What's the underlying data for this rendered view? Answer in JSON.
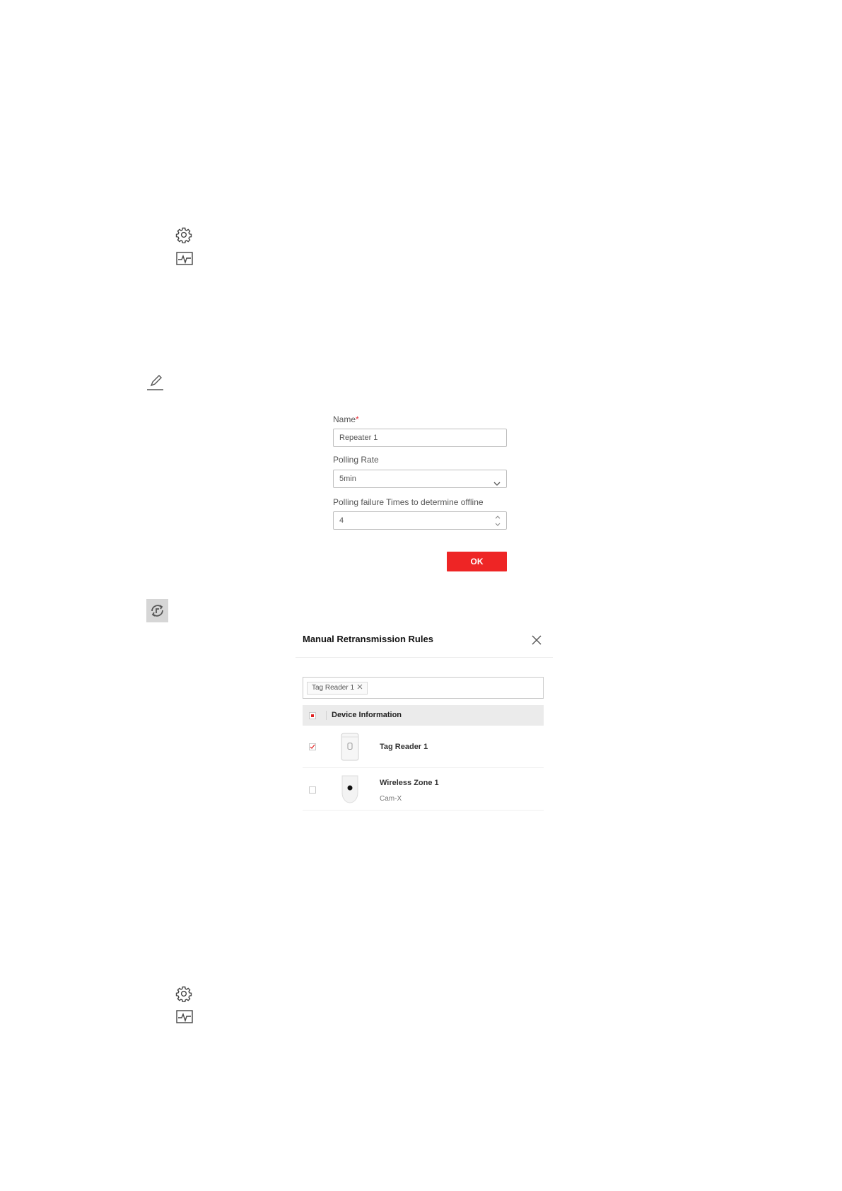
{
  "icons": {
    "gear": "gear-icon",
    "monitor": "status-monitor-icon",
    "edit": "edit-pencil-icon",
    "retransmission": "retransmission-icon"
  },
  "settings_form": {
    "name_label": "Name",
    "required_mark": "*",
    "name_value": "Repeater 1",
    "polling_rate_label": "Polling Rate",
    "polling_rate_value": "5min",
    "polling_failure_label": "Polling failure Times to determine offline",
    "polling_failure_value": "4",
    "ok_label": "OK"
  },
  "retransmission_panel": {
    "title": "Manual Retransmission Rules",
    "selected_tag": "Tag Reader 1",
    "header_label": "Device Information",
    "devices": [
      {
        "name": "Tag Reader 1",
        "subtitle": "",
        "checked": true
      },
      {
        "name": "Wireless Zone 1",
        "subtitle": "Cam-X",
        "checked": false
      }
    ]
  },
  "colors": {
    "accent": "#ee2525",
    "header_bg": "#ebebeb"
  }
}
